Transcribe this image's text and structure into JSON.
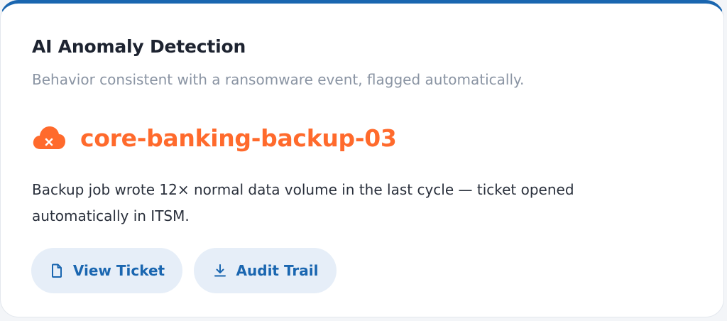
{
  "card": {
    "title": "AI Anomaly Detection",
    "subtitle": "Behavior consistent with a ransomware event, flagged automatically.",
    "host": {
      "icon": "cloud-error-icon",
      "name": "core-banking-backup-03"
    },
    "description": "Backup job wrote 12× normal data volume in the last cycle — ticket opened automatically in ITSM.",
    "actions": [
      {
        "label": "View Ticket",
        "icon": "file-icon"
      },
      {
        "label": "Audit Trail",
        "icon": "download-icon"
      }
    ]
  },
  "colors": {
    "accent": "#1a66b0",
    "alert": "#ff6a2c",
    "button_bg": "#e6eef8"
  }
}
